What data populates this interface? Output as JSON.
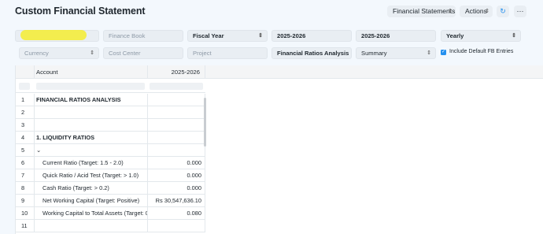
{
  "page": {
    "title": "Custom Financial Statement"
  },
  "toolbar": {
    "financial_statements_label": "Financial Statements",
    "actions_label": "Actions",
    "refresh_icon": "refresh-icon",
    "more_icon": "more-icon"
  },
  "filters": {
    "company": {
      "value": "",
      "redacted": true
    },
    "finance_book": {
      "placeholder": "Finance Book"
    },
    "period_type": {
      "value": "Fiscal Year"
    },
    "from_year": {
      "value": "2025-2026"
    },
    "to_year": {
      "value": "2025-2026"
    },
    "periodicity": {
      "value": "Yearly"
    },
    "currency": {
      "placeholder": "Currency"
    },
    "cost_center": {
      "placeholder": "Cost Center"
    },
    "project": {
      "placeholder": "Project"
    },
    "report_template": {
      "value": "Financial Ratios Analysis"
    },
    "view": {
      "value": "Summary"
    },
    "include_default_fb": {
      "label": "Include Default FB Entries",
      "checked": true
    }
  },
  "grid": {
    "columns": [
      "Account",
      "2025-2026"
    ],
    "rows": [
      {
        "num": "1",
        "account": "FINANCIAL RATIOS ANALYSIS",
        "value": "",
        "style": "bold"
      },
      {
        "num": "2",
        "account": "",
        "value": "",
        "style": ""
      },
      {
        "num": "3",
        "account": "",
        "value": "",
        "style": ""
      },
      {
        "num": "4",
        "account": "1. LIQUIDITY RATIOS",
        "value": "",
        "style": "bold"
      },
      {
        "num": "5",
        "account": "⌄",
        "value": "",
        "style": ""
      },
      {
        "num": "6",
        "account": "Current Ratio (Target: 1.5 - 2.0)",
        "value": "0.000",
        "style": "indent"
      },
      {
        "num": "7",
        "account": "Quick Ratio / Acid Test (Target: > 1.0)",
        "value": "0.000",
        "style": "indent"
      },
      {
        "num": "8",
        "account": "Cash Ratio (Target: > 0.2)",
        "value": "0.000",
        "style": "indent"
      },
      {
        "num": "9",
        "account": "Net Working Capital (Target: Positive)",
        "value": "Rs 30,547,636.10",
        "style": "indent"
      },
      {
        "num": "10",
        "account": "Working Capital to Total Assets (Target: 0",
        "value": "0.080",
        "style": "indent"
      },
      {
        "num": "11",
        "account": "",
        "value": "",
        "style": ""
      }
    ]
  }
}
